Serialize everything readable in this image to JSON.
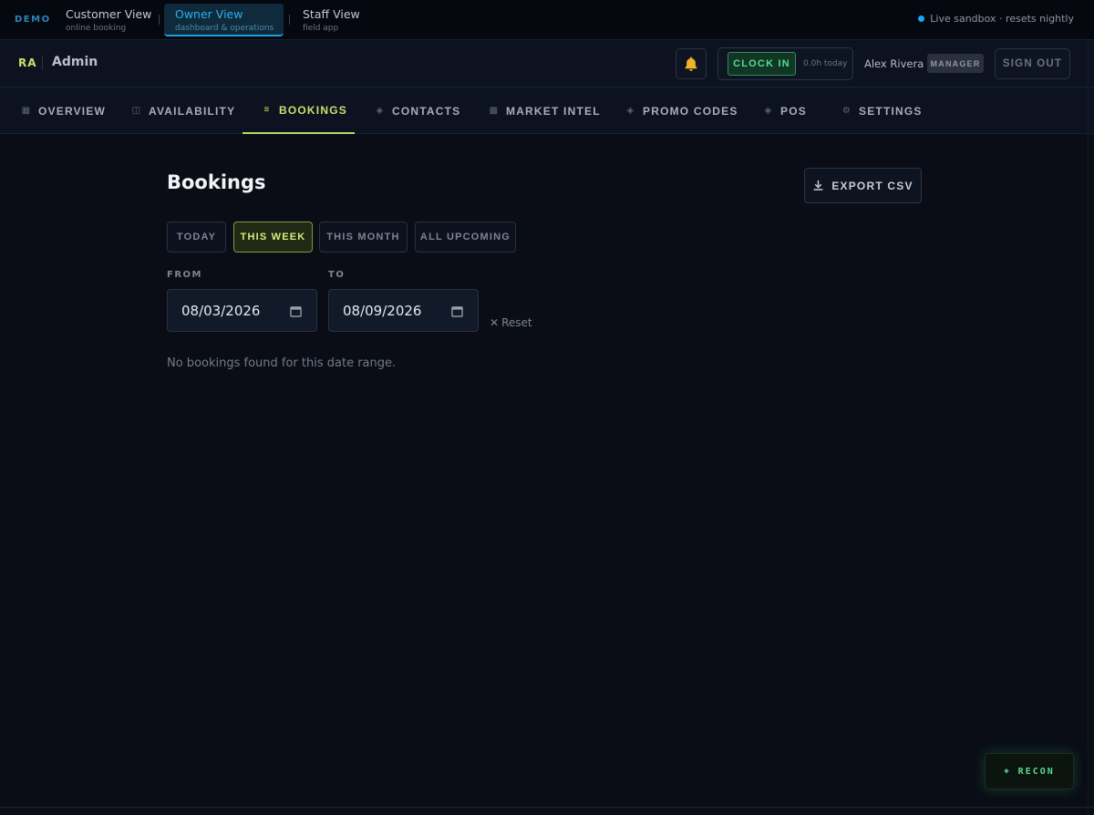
{
  "demo_bar": {
    "label": "DEMO",
    "views": [
      {
        "title": "Customer View",
        "subtitle": "online booking"
      },
      {
        "title": "Owner View",
        "subtitle": "dashboard & operations"
      },
      {
        "title": "Staff View",
        "subtitle": "field app"
      }
    ],
    "sandbox_text": "Live sandbox · resets nightly"
  },
  "header": {
    "brand_initials": "RA",
    "brand_label": "Admin",
    "clock_in_label": "CLOCK IN",
    "hours_today": "0.0h today",
    "user_name": "Alex Rivera",
    "role": "MANAGER",
    "sign_out_label": "SIGN OUT"
  },
  "nav": {
    "items": [
      {
        "label": "OVERVIEW",
        "icon": "grid-icon"
      },
      {
        "label": "AVAILABILITY",
        "icon": "calendar-icon"
      },
      {
        "label": "BOOKINGS",
        "icon": "list-icon"
      },
      {
        "label": "CONTACTS",
        "icon": "diamond-icon"
      },
      {
        "label": "MARKET INTEL",
        "icon": "chart-icon"
      },
      {
        "label": "PROMO CODES",
        "icon": "diamond-icon"
      },
      {
        "label": "POS",
        "icon": "diamond-icon"
      },
      {
        "label": "SETTINGS",
        "icon": "gear-icon"
      }
    ],
    "active": "BOOKINGS"
  },
  "main": {
    "title": "Bookings",
    "export_label": "EXPORT CSV",
    "filters": [
      "TODAY",
      "THIS WEEK",
      "THIS MONTH",
      "ALL UPCOMING"
    ],
    "active_filter": "THIS WEEK",
    "from_label": "FROM",
    "to_label": "TO",
    "from_value": "08/03/2026",
    "to_value": "08/09/2026",
    "reset_label": "Reset",
    "empty_message": "No bookings found for this date range."
  },
  "recon_label": "RECON",
  "colors": {
    "accent": "#c7e26b",
    "owner_view": "#2bb0f0",
    "clock_in": "#4de08f",
    "background": "#0a0d16"
  }
}
